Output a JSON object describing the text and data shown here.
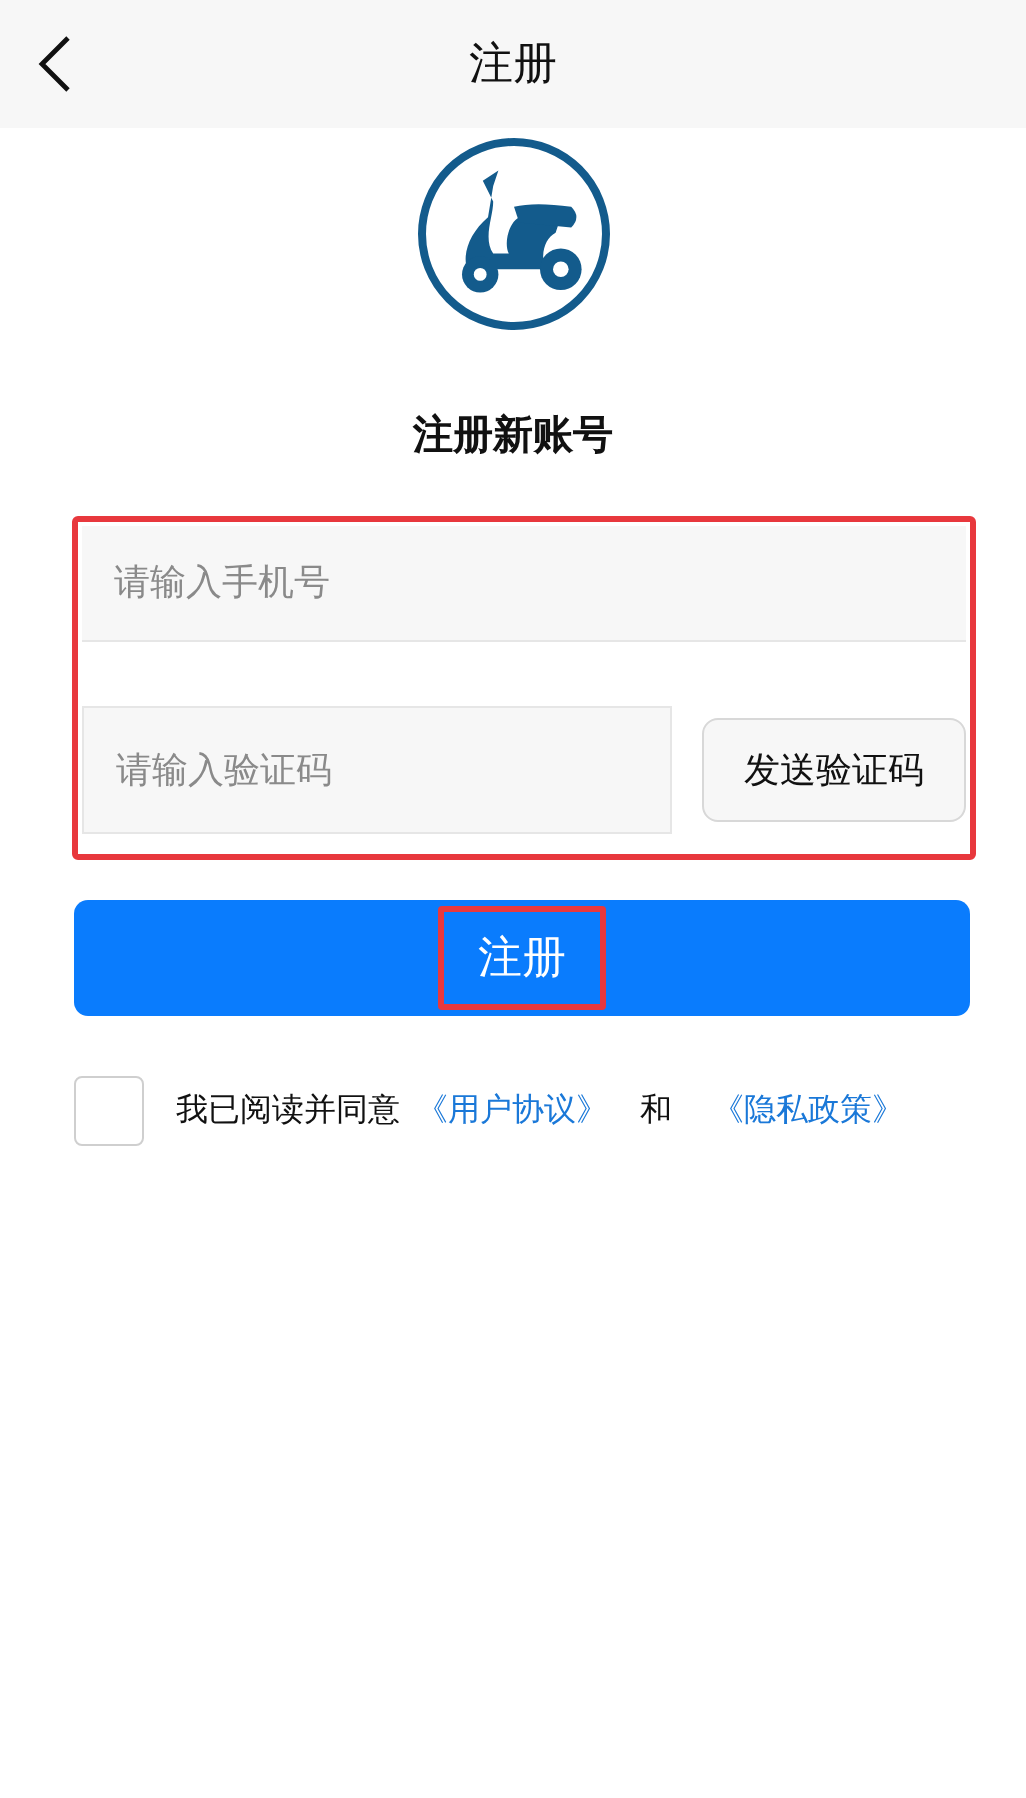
{
  "header": {
    "title": "注册"
  },
  "heading": "注册新账号",
  "form": {
    "highlighted": true,
    "phone": {
      "placeholder": "请输入手机号"
    },
    "code": {
      "placeholder": "请输入验证码"
    },
    "send_button": "发送验证码"
  },
  "register_button": {
    "label": "注册",
    "highlighted": true
  },
  "agreement": {
    "checked": false,
    "text": "我已阅读并同意",
    "link_1": "《用户协议》",
    "conjunction": "和",
    "link_2": "《隐私政策》"
  }
}
